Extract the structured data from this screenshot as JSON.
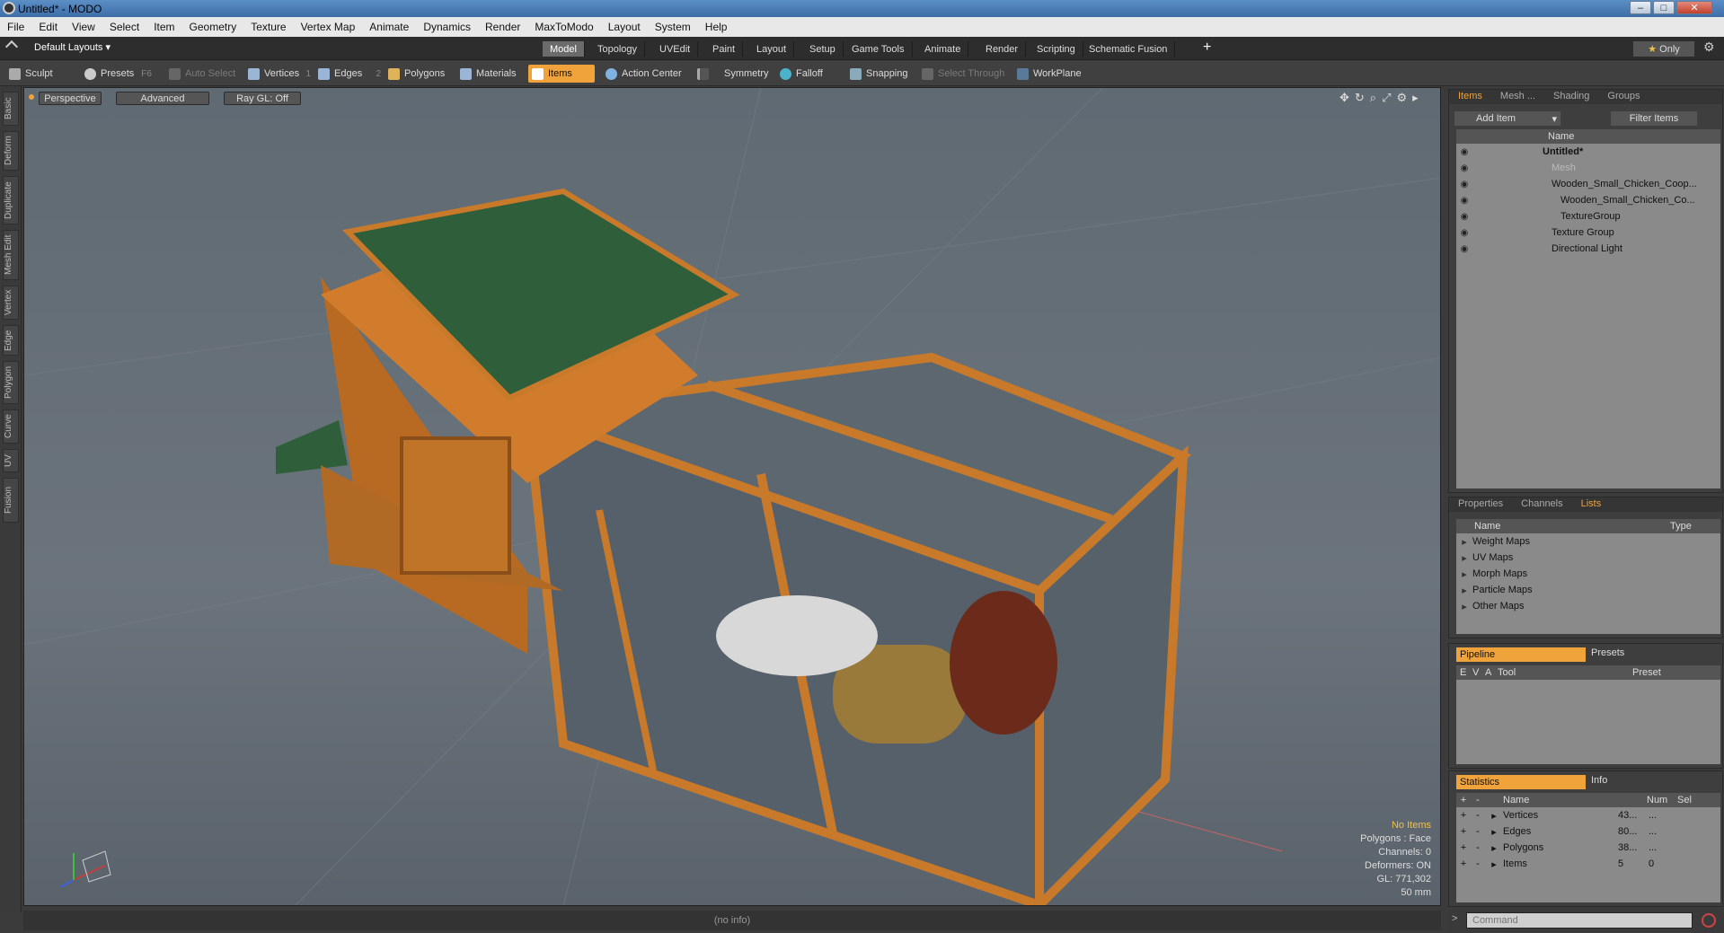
{
  "window": {
    "title": "Untitled* - MODO"
  },
  "menu": [
    "File",
    "Edit",
    "View",
    "Select",
    "Item",
    "Geometry",
    "Texture",
    "Vertex Map",
    "Animate",
    "Dynamics",
    "Render",
    "MaxToModo",
    "Layout",
    "System",
    "Help"
  ],
  "layouts": {
    "dropdown": "Default Layouts",
    "tabs": [
      "Model",
      "Topology",
      "UVEdit",
      "Paint",
      "Layout",
      "Setup",
      "Game Tools",
      "Animate",
      "Render",
      "Scripting",
      "Schematic Fusion"
    ],
    "active": "Model",
    "only": "Only"
  },
  "toolbar": {
    "sculpt": "Sculpt",
    "presets": "Presets",
    "presets_key": "F6",
    "auto_select": "Auto Select",
    "vertices": "Vertices",
    "vertices_key": "1",
    "edges": "Edges",
    "edges_key": "2",
    "polygons": "Polygons",
    "materials": "Materials",
    "items": "Items",
    "action_center": "Action Center",
    "symmetry": "Symmetry",
    "falloff": "Falloff",
    "snapping": "Snapping",
    "select_through": "Select Through",
    "workplane": "WorkPlane"
  },
  "left_tabs": [
    "Basic",
    "Deform",
    "Duplicate",
    "Mesh Edit",
    "Vertex",
    "Edge",
    "Polygon",
    "Curve",
    "UV",
    "Fusion"
  ],
  "viewport": {
    "view": "Perspective",
    "shading": "Advanced",
    "raygl": "Ray GL: Off",
    "info": {
      "no_items": "No Items",
      "polygons": "Polygons : Face",
      "channels": "Channels: 0",
      "deformers": "Deformers: ON",
      "gl": "GL: 771,302",
      "size": "50 mm"
    }
  },
  "items_panel": {
    "tabs": [
      "Items",
      "Mesh ...",
      "Shading",
      "Groups"
    ],
    "add_item": "Add Item",
    "filter": "Filter Items",
    "col_name": "Name",
    "tree": [
      "Untitled*",
      "Mesh",
      "Wooden_Small_Chicken_Coop...",
      "Wooden_Small_Chicken_Co...",
      "TextureGroup",
      "Texture Group",
      "Directional Light"
    ]
  },
  "lists_panel": {
    "tabs": [
      "Properties",
      "Channels",
      "Lists"
    ],
    "col_name": "Name",
    "col_type": "Type",
    "rows": [
      "Weight Maps",
      "UV Maps",
      "Morph Maps",
      "Particle Maps",
      "Other Maps"
    ]
  },
  "pipeline_panel": {
    "tabs": [
      "Pipeline",
      "Presets"
    ],
    "cols": [
      "E",
      "V",
      "A",
      "Tool",
      "Preset"
    ]
  },
  "stats_panel": {
    "tabs": [
      "Statistics",
      "Info"
    ],
    "cols": [
      "Name",
      "Num",
      "Sel"
    ],
    "rows": [
      {
        "name": "Vertices",
        "num": "43...",
        "sel": "..."
      },
      {
        "name": "Edges",
        "num": "80...",
        "sel": "..."
      },
      {
        "name": "Polygons",
        "num": "38...",
        "sel": "..."
      },
      {
        "name": "Items",
        "num": "5",
        "sel": "0"
      }
    ]
  },
  "status": {
    "info": "(no info)",
    "command_placeholder": "Command"
  }
}
